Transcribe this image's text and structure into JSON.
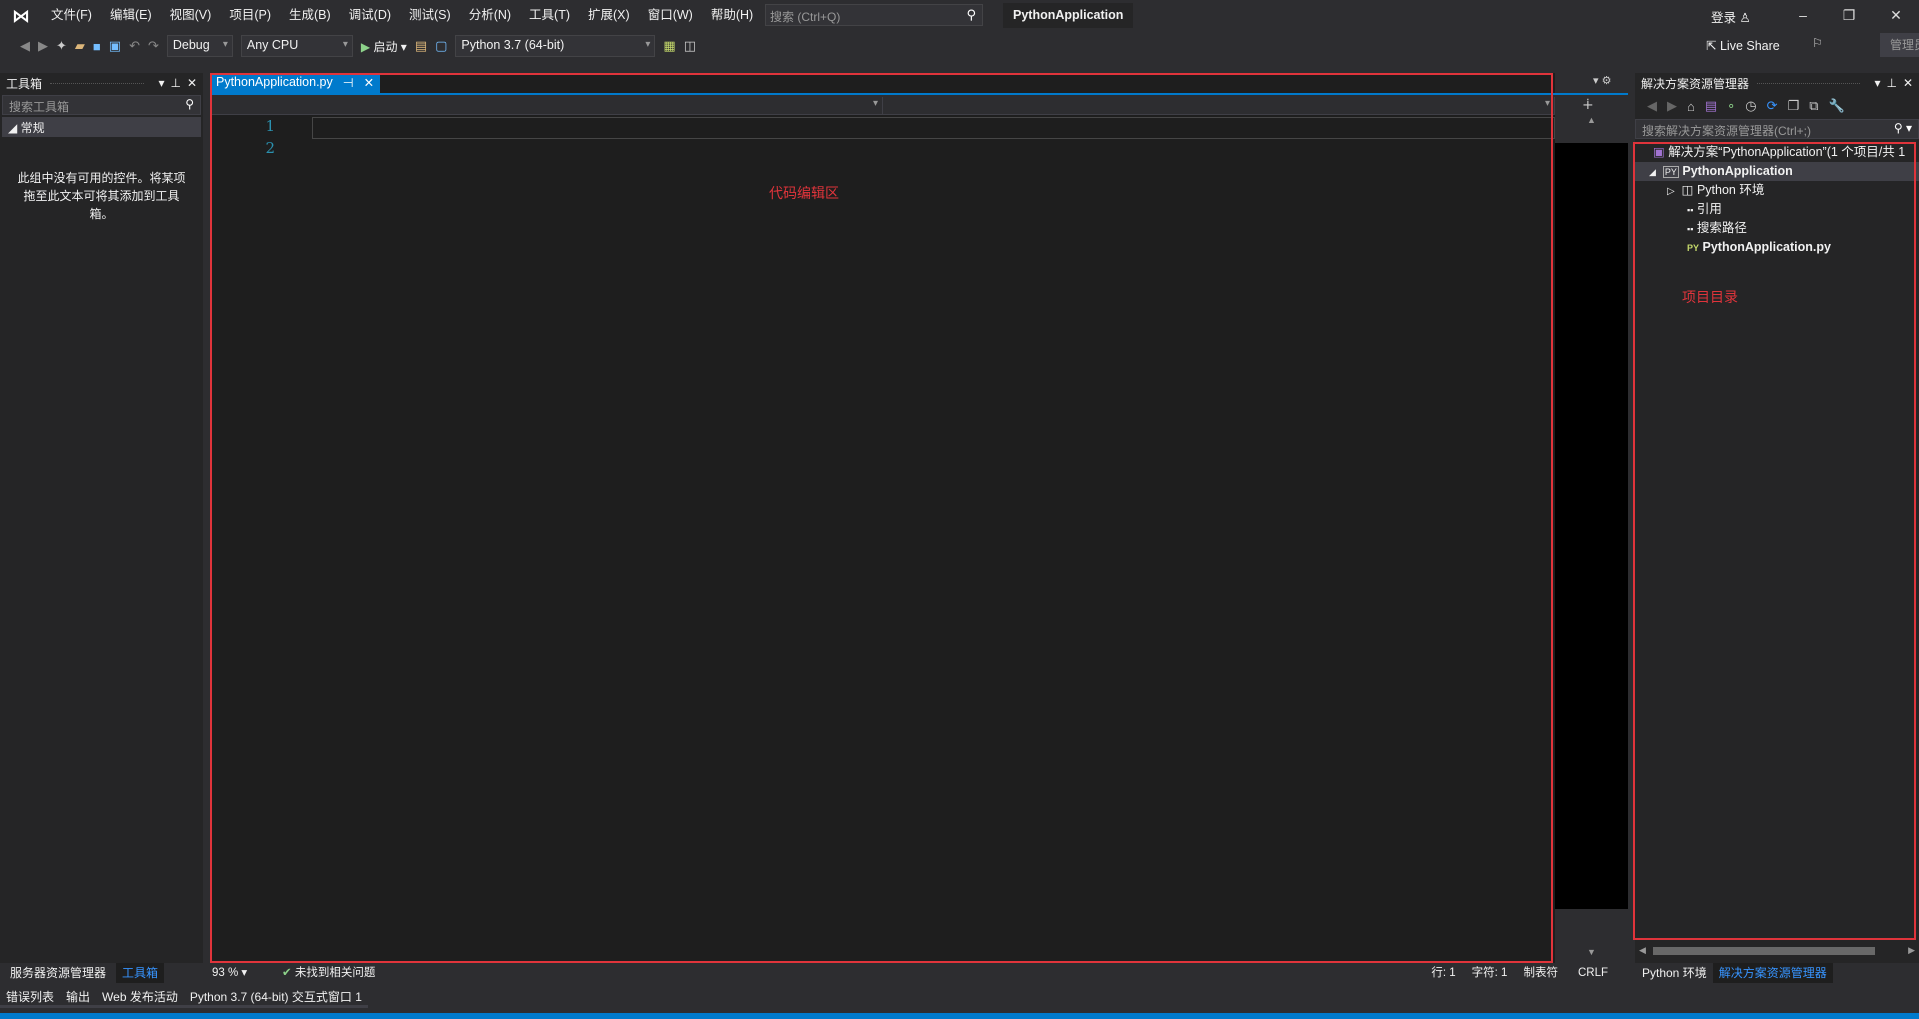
{
  "app": {
    "logo_icon": "visual-studio-logo",
    "title": "PythonApplication",
    "login": "登录",
    "admin": "管理员",
    "live_share": "Live Share"
  },
  "menu": [
    "文件(F)",
    "编辑(E)",
    "视图(V)",
    "项目(P)",
    "生成(B)",
    "调试(D)",
    "测试(S)",
    "分析(N)",
    "工具(T)",
    "扩展(X)",
    "窗口(W)",
    "帮助(H)"
  ],
  "search": {
    "placeholder": "搜索 (Ctrl+Q)"
  },
  "toolbar": {
    "config": "Debug",
    "platform": "Any CPU",
    "start": "启动",
    "environment": "Python 3.7 (64-bit)"
  },
  "toolbox": {
    "title": "工具箱",
    "search_placeholder": "搜索工具箱",
    "group": "常规",
    "empty_text": "此组中没有可用的控件。将某项拖至此文本可将其添加到工具箱。"
  },
  "editor": {
    "tab": "PythonApplication.py",
    "lines": [
      "1",
      "2"
    ],
    "annotation": "代码编辑区",
    "zoom": "93 %",
    "issues": "未找到相关问题",
    "row": "行: 1",
    "col": "字符: 1",
    "tabs": "制表符",
    "eol": "CRLF"
  },
  "solution": {
    "title": "解决方案资源管理器",
    "search_placeholder": "搜索解决方案资源管理器(Ctrl+;)",
    "annotation": "项目目录",
    "tree": [
      {
        "label": "解决方案“PythonApplication”(1 个项目/共 1",
        "icon": "solution-icon"
      },
      {
        "label": "PythonApplication",
        "icon": "python-project-icon"
      },
      {
        "label": "Python 环境",
        "icon": "environment-icon"
      },
      {
        "label": "引用",
        "icon": "reference-icon"
      },
      {
        "label": "搜索路径",
        "icon": "search-path-icon"
      },
      {
        "label": "PythonApplication.py",
        "icon": "python-file-icon"
      }
    ]
  },
  "left_tabs": [
    "服务器资源管理器",
    "工具箱"
  ],
  "right_tabs": [
    "Python 环境",
    "解决方案资源管理器"
  ],
  "bottom_tabs": [
    "错误列表",
    "输出",
    "Web 发布活动",
    "Python 3.7 (64-bit) 交互式窗口 1"
  ],
  "colors": {
    "accent": "#007acc",
    "annotation": "#e0343b",
    "background": "#2d2d30",
    "editor": "#1e1e1e"
  }
}
